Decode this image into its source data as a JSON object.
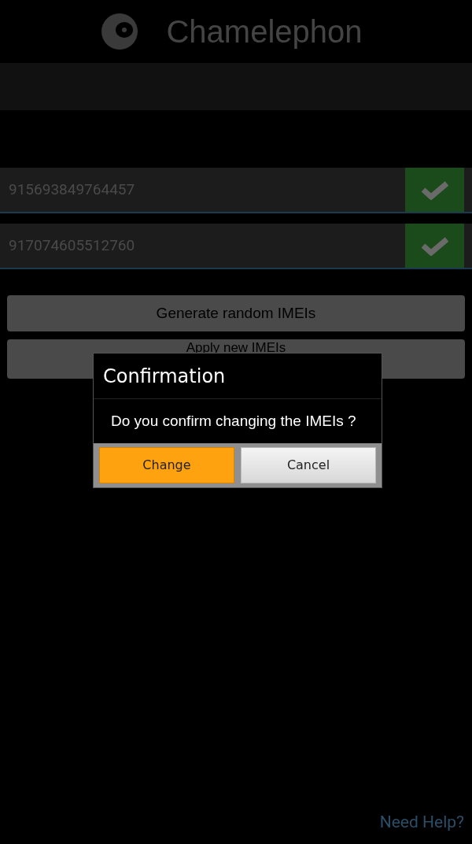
{
  "app_bar": {
    "title": "Chamelephon"
  },
  "imei_fields": [
    {
      "value": "915693849764457"
    },
    {
      "value": "917074605512760"
    }
  ],
  "buttons": [
    "Generate random IMEIs",
    "Apply new IMEIs"
  ],
  "dialog": {
    "title": "Confirmation",
    "message": "Do you confirm changing the IMEIs ?",
    "buttons": [
      {
        "label": "Change",
        "kind": "primary"
      },
      {
        "label": "Cancel",
        "kind": "secondary"
      }
    ]
  },
  "help_link": "Need Help?"
}
